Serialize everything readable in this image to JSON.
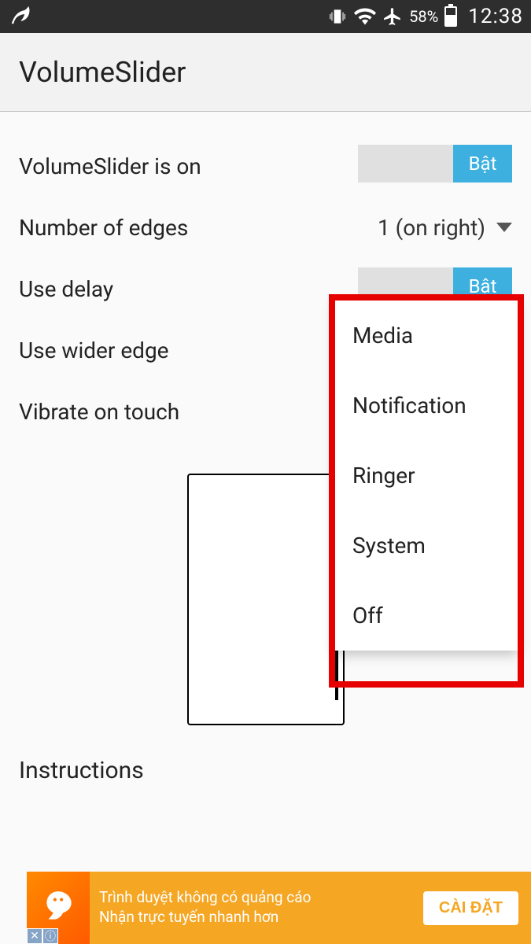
{
  "status_bar": {
    "battery_pct": "58%",
    "time": "12:38"
  },
  "app_bar": {
    "title": "VolumeSlider"
  },
  "settings": {
    "slider_on": {
      "label": "VolumeSlider is on",
      "toggle_label": "Bật"
    },
    "edges": {
      "label": "Number of edges",
      "value": "1 (on right)"
    },
    "use_delay": {
      "label": "Use delay",
      "toggle_label": "Bật"
    },
    "wider_edge": {
      "label": "Use wider edge"
    },
    "vibrate": {
      "label": "Vibrate on touch"
    }
  },
  "dropdown_menu": {
    "items": [
      "Media",
      "Notification",
      "Ringer",
      "System",
      "Off"
    ]
  },
  "instructions_heading": "Instructions",
  "ad": {
    "line1": "Trình duyệt không có quảng cáo",
    "line2": "Nhận trực tuyến nhanh hơn",
    "button": "CÀI ĐẶT"
  }
}
